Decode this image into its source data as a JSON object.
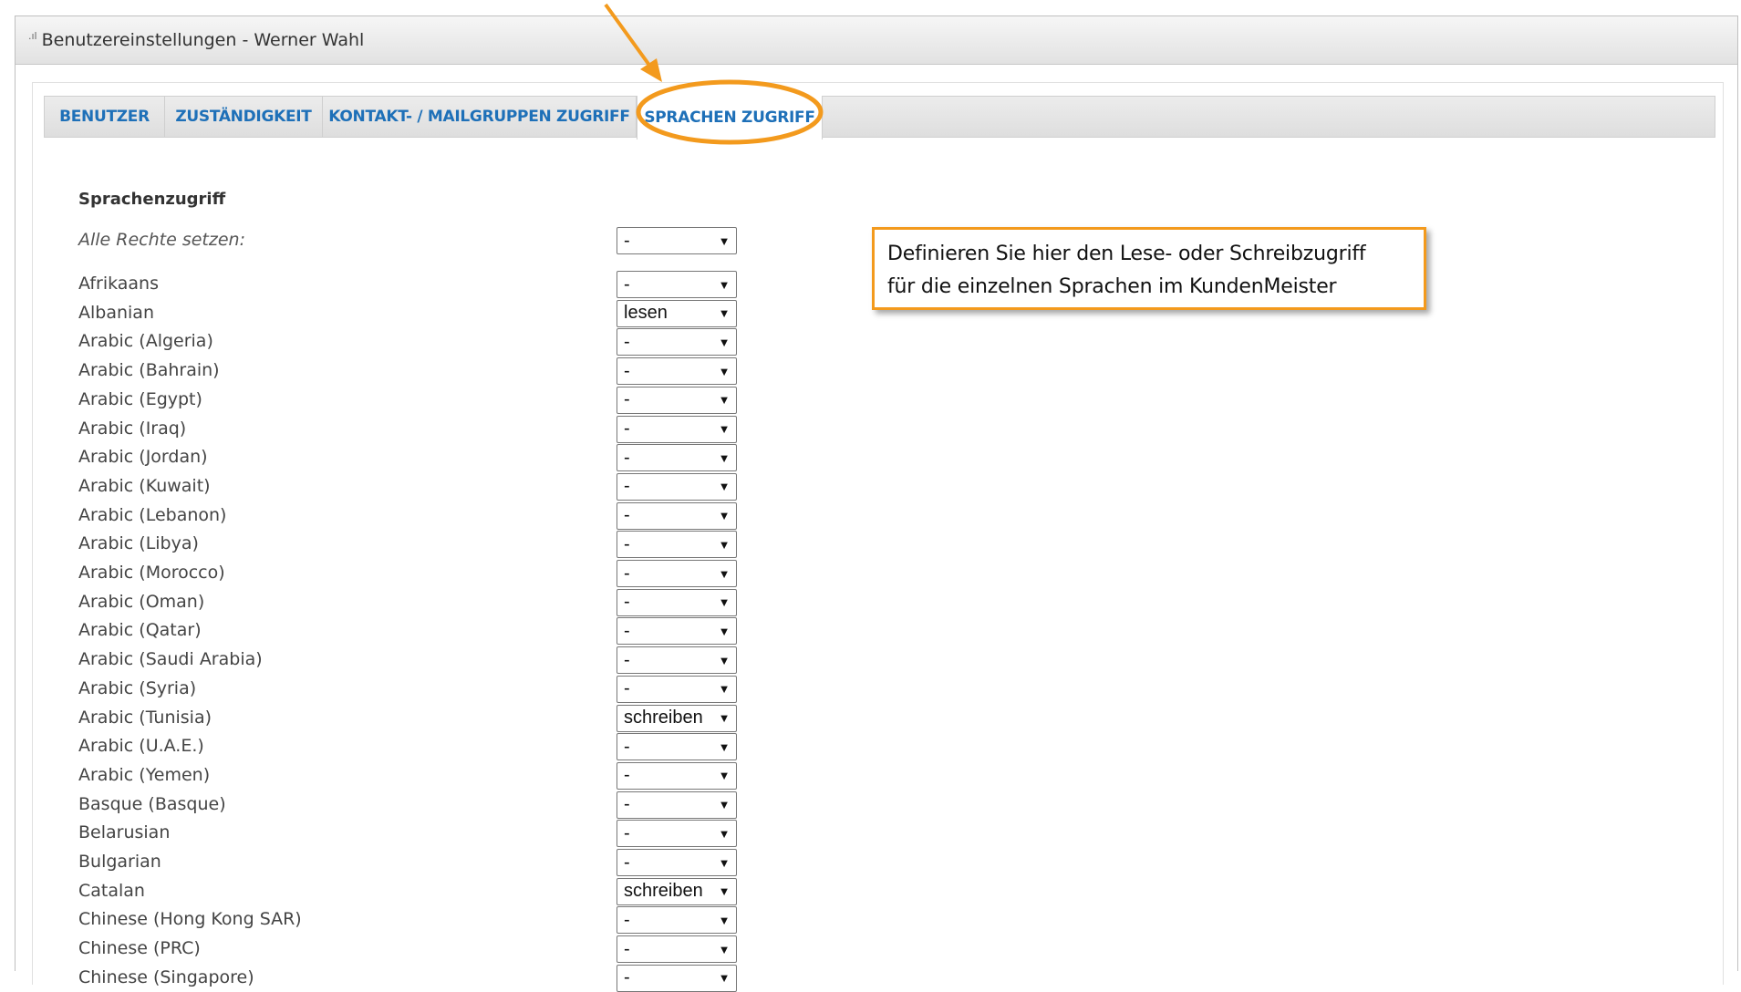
{
  "window": {
    "title": "Benutzereinstellungen - Werner Wahl",
    "icon": "signal-bars-icon"
  },
  "tabs": [
    {
      "label": "BENUTZER",
      "active": false
    },
    {
      "label": "ZUSTÄNDIGKEIT",
      "active": false
    },
    {
      "label": "KONTAKT- / MAILGRUPPEN ZUGRIFF",
      "active": false
    },
    {
      "label": "SPRACHEN ZUGRIFF",
      "active": true
    }
  ],
  "section": {
    "heading": "Sprachenzugriff",
    "set_all_label": "Alle Rechte setzen:",
    "set_all_value": "-"
  },
  "languages": [
    {
      "name": "Afrikaans",
      "access": "-"
    },
    {
      "name": "Albanian",
      "access": "lesen"
    },
    {
      "name": "Arabic (Algeria)",
      "access": "-"
    },
    {
      "name": "Arabic (Bahrain)",
      "access": "-"
    },
    {
      "name": "Arabic (Egypt)",
      "access": "-"
    },
    {
      "name": "Arabic (Iraq)",
      "access": "-"
    },
    {
      "name": "Arabic (Jordan)",
      "access": "-"
    },
    {
      "name": "Arabic (Kuwait)",
      "access": "-"
    },
    {
      "name": "Arabic (Lebanon)",
      "access": "-"
    },
    {
      "name": "Arabic (Libya)",
      "access": "-"
    },
    {
      "name": "Arabic (Morocco)",
      "access": "-"
    },
    {
      "name": "Arabic (Oman)",
      "access": "-"
    },
    {
      "name": "Arabic (Qatar)",
      "access": "-"
    },
    {
      "name": "Arabic (Saudi Arabia)",
      "access": "-"
    },
    {
      "name": "Arabic (Syria)",
      "access": "-"
    },
    {
      "name": "Arabic (Tunisia)",
      "access": "schreiben"
    },
    {
      "name": "Arabic (U.A.E.)",
      "access": "-"
    },
    {
      "name": "Arabic (Yemen)",
      "access": "-"
    },
    {
      "name": "Basque (Basque)",
      "access": "-"
    },
    {
      "name": "Belarusian",
      "access": "-"
    },
    {
      "name": "Bulgarian",
      "access": "-"
    },
    {
      "name": "Catalan",
      "access": "schreiben"
    },
    {
      "name": "Chinese (Hong Kong SAR)",
      "access": "-"
    },
    {
      "name": "Chinese (PRC)",
      "access": "-"
    },
    {
      "name": "Chinese (Singapore)",
      "access": "-"
    }
  ],
  "callout": {
    "line1": "Definieren Sie hier den Lese- oder Schreibzugriff",
    "line2": "für die einzelnen Sprachen im KundenMeister"
  },
  "colors": {
    "accent": "#f39a1d",
    "tab_text": "#1e70b8"
  }
}
